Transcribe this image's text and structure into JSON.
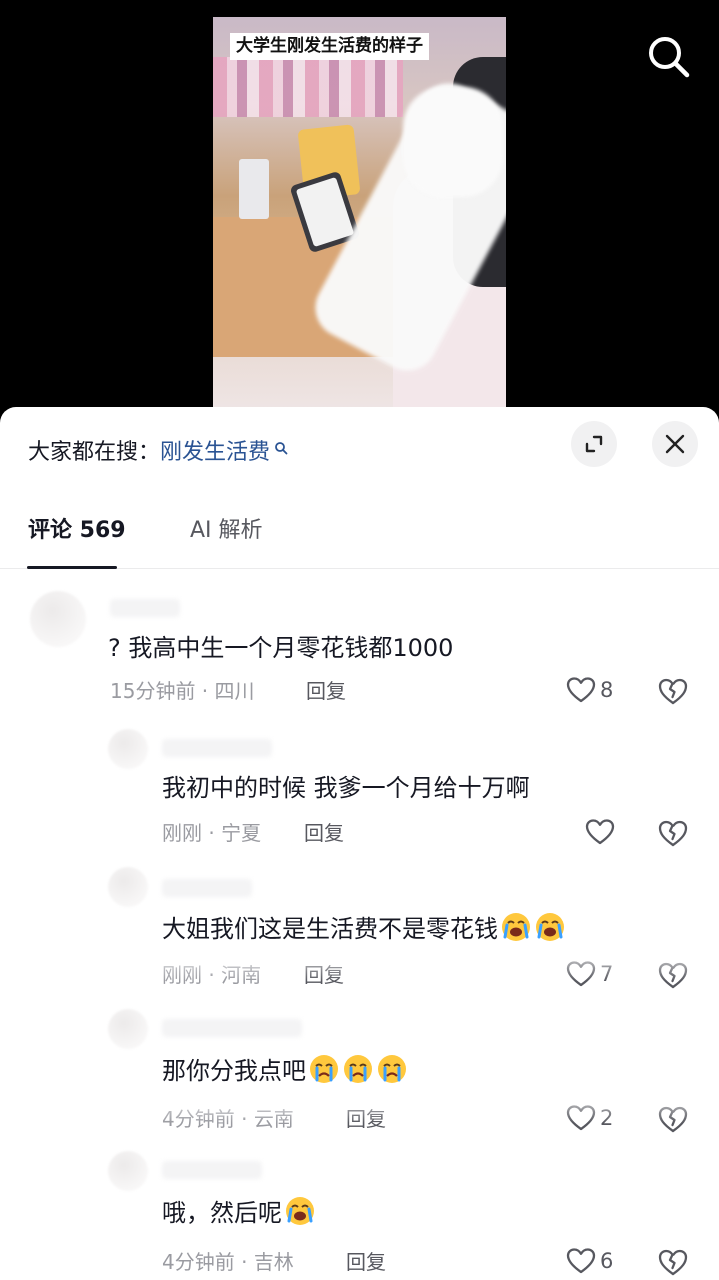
{
  "video": {
    "caption": "大学生刚发生活费的样子"
  },
  "hot_search": {
    "prefix": "大家都在搜：",
    "term": "刚发生活费"
  },
  "tabs": [
    {
      "label": "评论 569",
      "active": true
    },
    {
      "label": "AI 解析",
      "active": false
    }
  ],
  "comments": [
    {
      "text": "? 我高中生一个月零花钱都1000",
      "time": "15分钟前",
      "location": "四川",
      "reply": "回复",
      "likes": "8",
      "emojis": 0
    },
    {
      "text": "我初中的时候 我爹一个月给十万啊",
      "time": "刚刚",
      "location": "宁夏",
      "reply": "回复",
      "likes": "",
      "emojis": 0
    },
    {
      "text": "大姐我们这是生活费不是零花钱",
      "time": "刚刚",
      "location": "河南",
      "reply": "回复",
      "likes": "7",
      "emojis": 2
    },
    {
      "text": "那你分我点吧",
      "time": "4分钟前",
      "location": "云南",
      "reply": "回复",
      "likes": "2",
      "emojis": 3
    },
    {
      "text": "哦，然后呢",
      "time": "4分钟前",
      "location": "吉林",
      "reply": "回复",
      "likes": "6",
      "emojis": 1
    }
  ],
  "meta_separator": " · ",
  "colors": {
    "hot_term": "#2a5393",
    "text": "#161823",
    "muted": "#9a9ba1",
    "emoji_face": "#ffc83d",
    "emoji_tear": "#3aa0ff"
  },
  "icons": [
    "search-icon",
    "expand-icon",
    "close-icon",
    "heart-icon",
    "broken-heart-icon",
    "crying-emoji-icon"
  ]
}
